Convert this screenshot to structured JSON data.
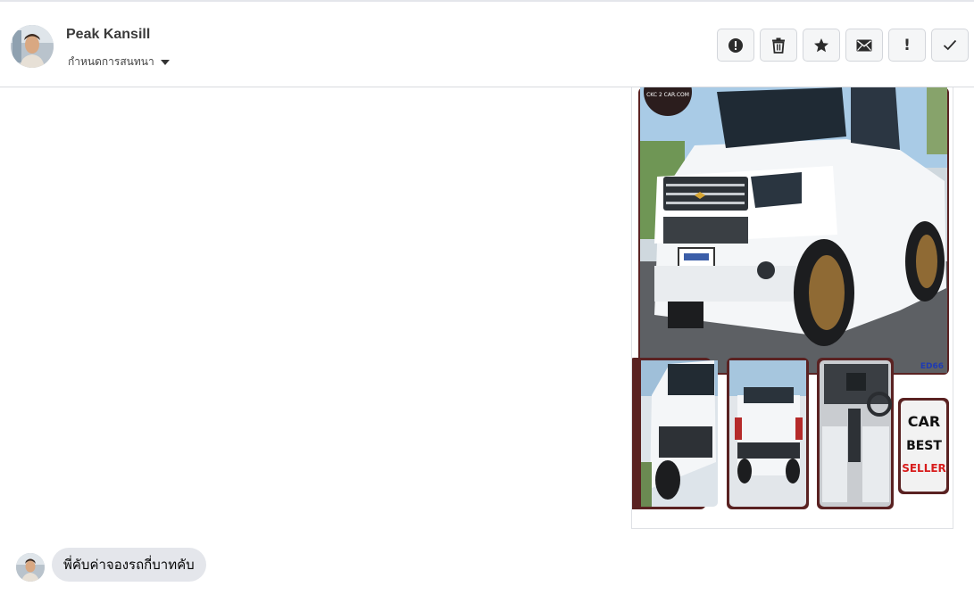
{
  "contact": {
    "name": "Peak Kansill",
    "conversation_label": "กำหนดการสนทนา"
  },
  "toolbar": {
    "buttons": [
      {
        "icon": "alert-circle-icon",
        "label": ""
      },
      {
        "icon": "trash-icon",
        "label": ""
      },
      {
        "icon": "star-icon",
        "label": ""
      },
      {
        "icon": "envelope-icon",
        "label": ""
      },
      {
        "icon": "exclamation-icon",
        "label": "!"
      },
      {
        "icon": "check-icon",
        "label": ""
      }
    ]
  },
  "attachment": {
    "watermark": "CKC 2 CAR.COM",
    "code": "ED66",
    "badge_line1": "CAR",
    "badge_line2": "BEST",
    "badge_line3": "SELLER"
  },
  "message": {
    "text": "พี่คับค่าจองรถกี่บาทคับ"
  }
}
